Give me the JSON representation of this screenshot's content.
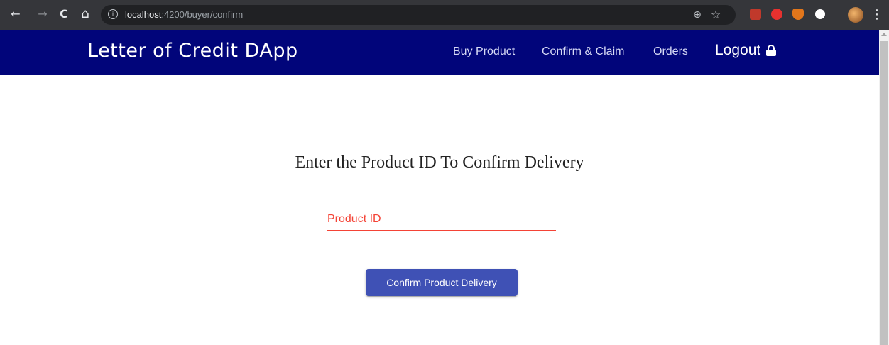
{
  "browser": {
    "url_host": "localhost",
    "url_rest": ":4200/buyer/confirm",
    "icons": [
      "back-icon",
      "forward-icon",
      "reload-icon",
      "home-icon",
      "info-icon",
      "zoom-icon",
      "star-icon",
      "pdf-extension-icon",
      "adblock-extension-icon",
      "metamask-extension-icon",
      "extension-icon",
      "profile-avatar",
      "menu-icon"
    ],
    "glyphs": {
      "back": "←",
      "forward": "→",
      "reload": "C",
      "home": "⌂",
      "info": "i",
      "zoom": "⊕",
      "star": "☆",
      "menu": "⋮"
    }
  },
  "header": {
    "brand": "Letter of Credit DApp",
    "nav": [
      "Buy Product",
      "Confirm & Claim",
      "Orders"
    ],
    "logout": "Logout",
    "background": "#01057a"
  },
  "main": {
    "heading": "Enter the Product ID To Confirm Delivery",
    "input_label": "Product ID",
    "button_label": "Confirm Product Delivery",
    "accent": "#3f51b5",
    "error_color": "#f44336"
  }
}
